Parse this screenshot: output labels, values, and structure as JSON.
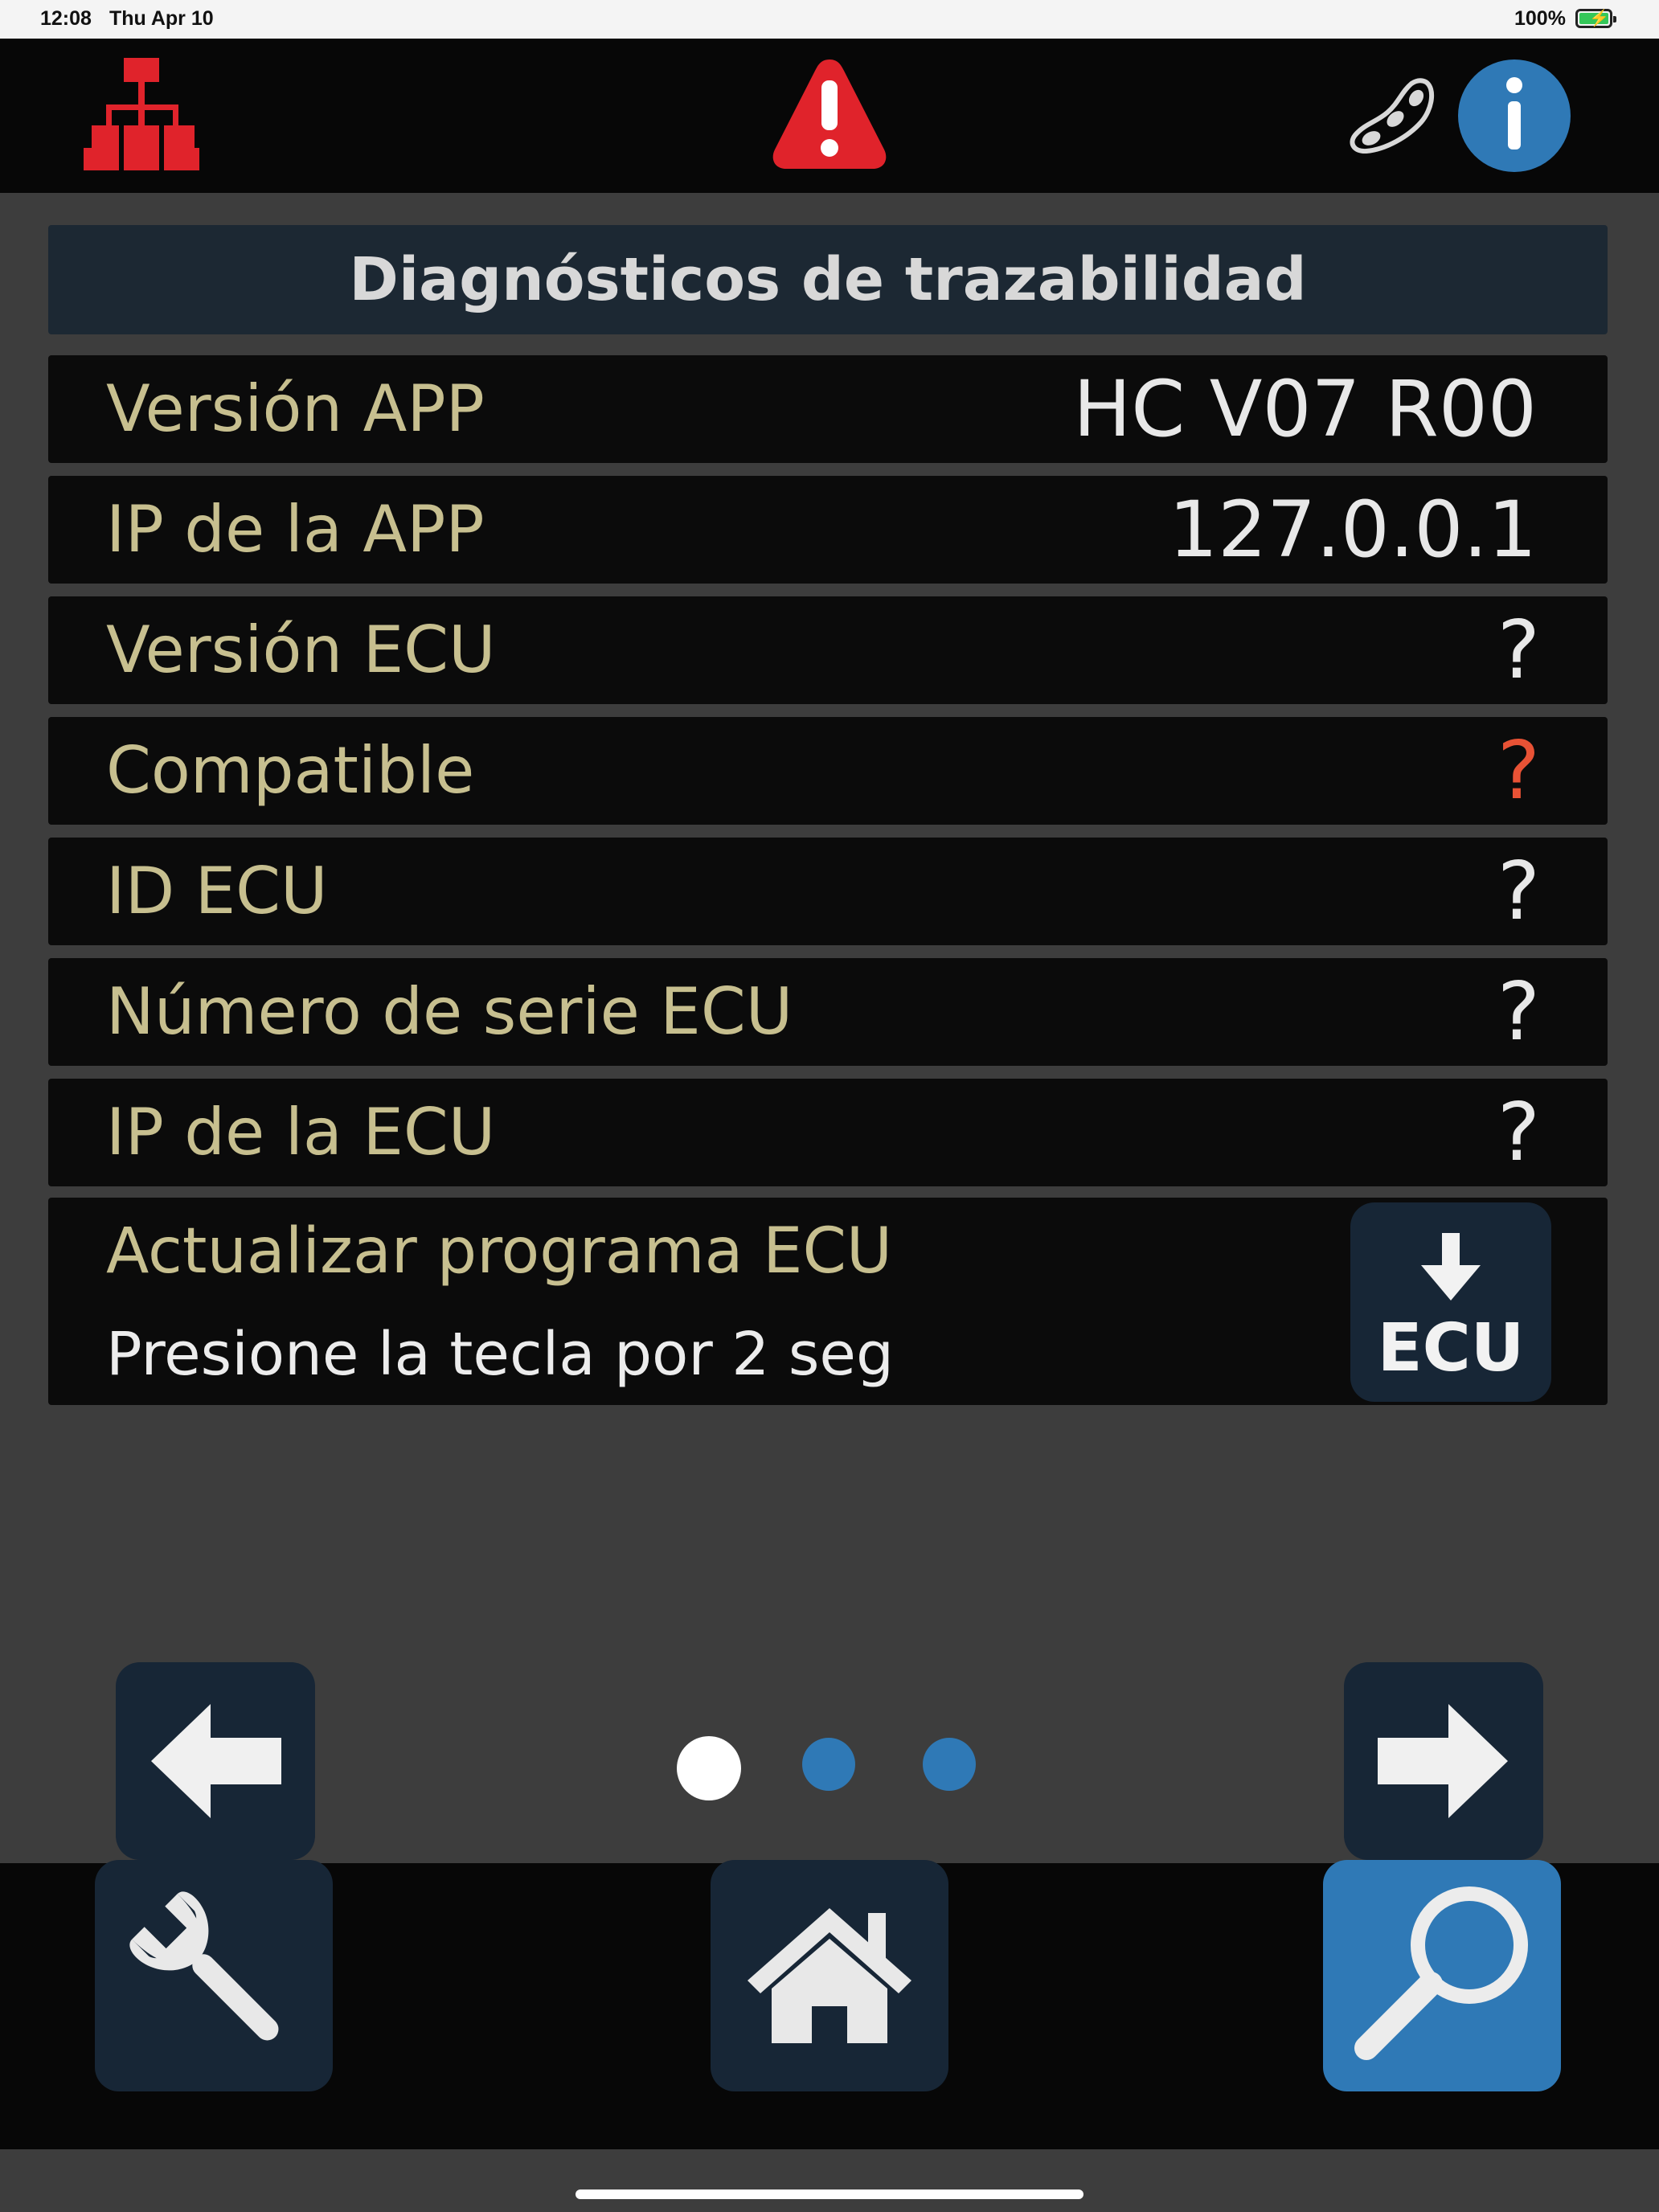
{
  "status_bar": {
    "time": "12:08",
    "date": "Thu Apr 10",
    "battery": "100%"
  },
  "top_bar": {
    "icons": [
      "network-icon",
      "alert-icon",
      "bean-icon",
      "info-icon"
    ],
    "accent_red": "#e0232b",
    "accent_blue": "#2f79b6"
  },
  "page": {
    "title": "Diagnósticos de trazabilidad"
  },
  "rows": [
    {
      "label": "Versión APP",
      "value": "HC V07 R00"
    },
    {
      "label": "IP de la APP",
      "value": "127.0.0.1"
    },
    {
      "label": "Versión ECU",
      "value": "?"
    },
    {
      "label": "Compatible",
      "value": "?"
    },
    {
      "label": "ID ECU",
      "value": "?"
    },
    {
      "label": "Número de serie ECU",
      "value": "?"
    },
    {
      "label": "IP de la ECU",
      "value": "?"
    }
  ],
  "update": {
    "title": "Actualizar programa ECU",
    "hint": "Presione la tecla por 2 seg",
    "button_label": "ECU"
  },
  "pager": {
    "active_page": 1,
    "page_count": 3
  },
  "bottom_tabs": {
    "icons": [
      "wrench-icon",
      "home-icon",
      "magnifier-icon"
    ],
    "selected": "magnifier-icon"
  }
}
